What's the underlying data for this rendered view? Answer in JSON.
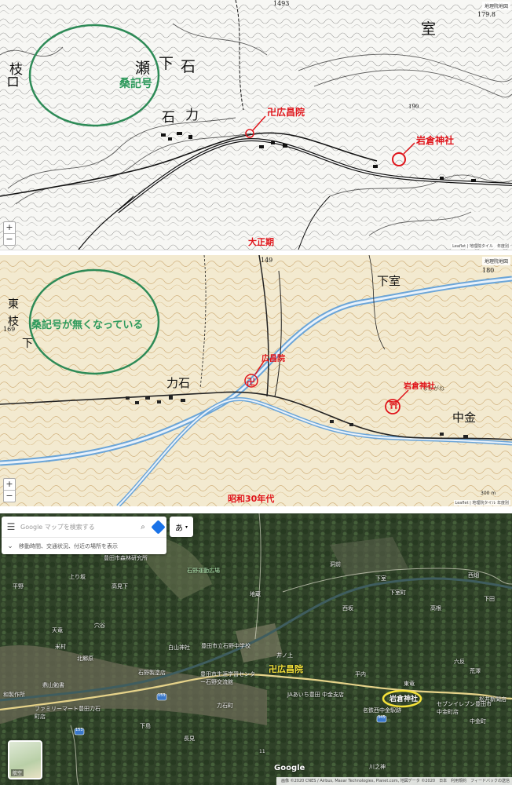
{
  "map_taisho": {
    "source_label": "地理院地図",
    "height_marks": [
      "1493",
      "179.8",
      "190"
    ],
    "place_chars": [
      "瀬",
      "下",
      "石",
      "枝",
      "石",
      "力",
      "室",
      "ロ"
    ],
    "annotation_circle_label": "桑記号",
    "temple_label": "卍広昌院",
    "shrine_label": "岩倉神社",
    "era_label": "大正期",
    "zoom_in": "+",
    "zoom_out": "−",
    "attribution": "Leaflet | 地理院タイル　年度別"
  },
  "map_showa": {
    "source_label": "地理院地図",
    "height_marks": [
      "149",
      "180",
      "169"
    ],
    "place_chars": [
      "下室",
      "力石",
      "中金",
      "東",
      "枝",
      "下",
      "なかがね"
    ],
    "annotation_circle_label": "桑記号が無くなっている",
    "temple_label": "広昌院",
    "shrine_label": "岩倉神社",
    "temple_symbol": "卍",
    "shrine_symbol": "⛩",
    "era_label": "昭和30年代",
    "scale": "300 m",
    "zoom_in": "+",
    "zoom_out": "−",
    "attribution": "Leaflet | 地理院タイル 年度別"
  },
  "google_map": {
    "search_placeholder": "Google マップを検索する",
    "ime_label": "あ",
    "secondary_text": "移動時間、交通状況、付近の場所を表示",
    "layer_button_label": "航空",
    "logo": "Google",
    "attribution": "画像 ©2020 CNES / Airbus, Maxar Technologies, Planet.com, 地図データ ©2020　日本　利用規約　フィードバックの送信",
    "temple_label": "卍広昌院",
    "shrine_label": "岩倉神社",
    "place_labels": [
      {
        "text": "豊田市森林研究所"
      },
      {
        "text": "石野運動広場"
      },
      {
        "text": "上り坂"
      },
      {
        "text": "高見下"
      },
      {
        "text": "平野"
      },
      {
        "text": "西畑"
      },
      {
        "text": "洞前"
      },
      {
        "text": "下室"
      },
      {
        "text": "地蔵"
      },
      {
        "text": "下室町"
      },
      {
        "text": "下田"
      },
      {
        "text": "西坂"
      },
      {
        "text": "高根"
      },
      {
        "text": "穴谷"
      },
      {
        "text": "天竜"
      },
      {
        "text": "米村"
      },
      {
        "text": "白山神社"
      },
      {
        "text": "豊田市立石野中学校"
      },
      {
        "text": "北郷原"
      },
      {
        "text": "石野製塗店"
      },
      {
        "text": "豊田市生涯学習センター石野交流館"
      },
      {
        "text": "力石町"
      },
      {
        "text": "鼎山勉書"
      },
      {
        "text": "和製作所"
      },
      {
        "text": "ファミリーマート豊田力石町店"
      },
      {
        "text": "JAあいち豊田 中金支店"
      },
      {
        "text": "セブンイレブン豊田市中金町店"
      },
      {
        "text": "名鉄西中金駅跡"
      },
      {
        "text": "松井新聞店"
      },
      {
        "text": "六反"
      },
      {
        "text": "荒澤"
      },
      {
        "text": "中金町"
      },
      {
        "text": "平内"
      },
      {
        "text": "井ノ上"
      },
      {
        "text": "長見"
      },
      {
        "text": "東竜"
      },
      {
        "text": "川之神"
      },
      {
        "text": "下島"
      }
    ],
    "route_shields": [
      "153",
      "153",
      "345",
      "11"
    ]
  }
}
